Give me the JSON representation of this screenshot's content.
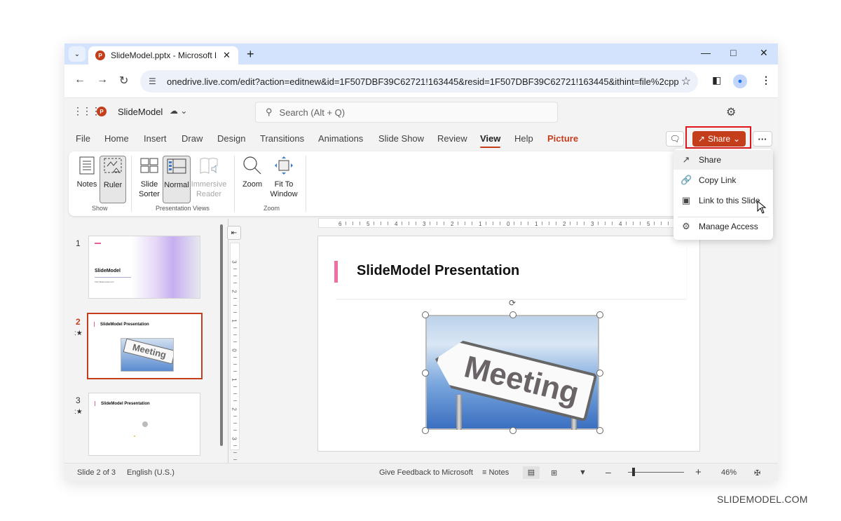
{
  "browser": {
    "tab_title": "SlideModel.pptx - Microsoft Po",
    "new_tab_label": "+",
    "url": "onedrive.live.com/edit?action=editnew&id=1F507DBF39C62721!163445&resid=1F507DBF39C62721!163445&ithint=file%2cpp..."
  },
  "app": {
    "logo_letter": "P",
    "document_name": "SlideModel",
    "search_placeholder": "Search (Alt + Q)"
  },
  "ribbon_tabs": [
    {
      "label": "File"
    },
    {
      "label": "Home"
    },
    {
      "label": "Insert"
    },
    {
      "label": "Draw"
    },
    {
      "label": "Design"
    },
    {
      "label": "Transitions"
    },
    {
      "label": "Animations"
    },
    {
      "label": "Slide Show"
    },
    {
      "label": "Review"
    },
    {
      "label": "View",
      "active": true
    },
    {
      "label": "Help"
    },
    {
      "label": "Picture",
      "contextual": true
    }
  ],
  "share_button": {
    "label": "Share"
  },
  "ribbon": {
    "show_group": {
      "label": "Show",
      "notes": "Notes",
      "ruler": "Ruler"
    },
    "views_group": {
      "label": "Presentation Views",
      "slide_sorter_1": "Slide",
      "slide_sorter_2": "Sorter",
      "normal": "Normal",
      "immersive_1": "Immersive",
      "immersive_2": "Reader"
    },
    "zoom_group": {
      "label": "Zoom",
      "zoom": "Zoom",
      "fit_1": "Fit To",
      "fit_2": "Window"
    }
  },
  "share_menu": {
    "items": [
      {
        "label": "Share",
        "icon": "share-icon"
      },
      {
        "label": "Copy Link",
        "icon": "link-icon"
      },
      {
        "label": "Link to this Slide",
        "icon": "slide-link-icon"
      },
      {
        "label": "Manage Access",
        "icon": "gear-icon"
      }
    ]
  },
  "thumbnails": [
    {
      "number": "1",
      "title": "SlideModel",
      "subtitle": "Visit Slidemodel.com"
    },
    {
      "number": "2",
      "title": "SlideModel Presentation",
      "selected": true,
      "has_animation": true,
      "image_text": "Meeting"
    },
    {
      "number": "3",
      "title": "SlideModel Presentation",
      "has_animation": true
    }
  ],
  "rulers": {
    "horizontal_labels": [
      "6",
      "5",
      "4",
      "3",
      "2",
      "1",
      "0",
      "1",
      "2",
      "3",
      "4",
      "5"
    ],
    "vertical_labels": [
      "3",
      "2",
      "1",
      "0",
      "1",
      "2",
      "3"
    ]
  },
  "slide": {
    "title": "SlideModel Presentation",
    "image_text": "Meeting"
  },
  "statusbar": {
    "slide_counter": "Slide 2 of 3",
    "language": "English (U.S.)",
    "feedback": "Give Feedback to Microsoft",
    "notes": "Notes",
    "zoom_level": "46%",
    "zoom_fraction": 0.1
  },
  "watermark": "SLIDEMODEL.COM",
  "colors": {
    "accent": "#c43e1c",
    "highlight_box": "#e0161b",
    "title_bar_pink": "#f06fa2"
  }
}
